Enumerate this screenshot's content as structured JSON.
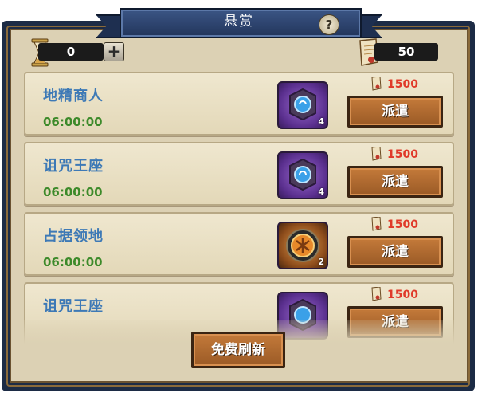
{
  "window": {
    "title": "悬赏",
    "help": "?"
  },
  "resources": {
    "left_value": "0",
    "plus": "+",
    "right_value": "50"
  },
  "bounties": [
    {
      "name": "地精商人",
      "time": "06:00:00",
      "item_type": "purple-gem-gear",
      "item_count": "4",
      "cost": "1500",
      "action": "派遣"
    },
    {
      "name": "诅咒王座",
      "time": "06:00:00",
      "item_type": "purple-gem-gear",
      "item_count": "4",
      "cost": "1500",
      "action": "派遣"
    },
    {
      "name": "占据领地",
      "time": "06:00:00",
      "item_type": "orange-medallion",
      "item_count": "2",
      "cost": "1500",
      "action": "派遣"
    },
    {
      "name": "诅咒王座",
      "item_type": "purple-gem-gear",
      "cost": "1500",
      "action": "派遣"
    }
  ],
  "footer": {
    "refresh_label": "免费刷新"
  },
  "colors": {
    "name": "#3d79b6",
    "time": "#3c8a2a",
    "cost": "#e03a2a",
    "button": "#b06a30",
    "frame": "#1c2b45",
    "parchment": "#dcd1b4"
  }
}
